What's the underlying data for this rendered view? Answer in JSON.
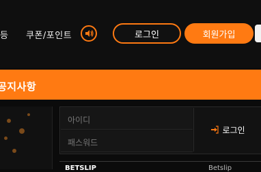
{
  "header": {
    "nav_partial": "등",
    "coupon_point_label": "쿠폰/포인트",
    "sound_icon": "speaker-icon",
    "login_button": "로그인",
    "signup_button": "회원가입"
  },
  "colors": {
    "accent": "#ff7a12",
    "background": "#0b0b0b",
    "panel": "#121212"
  },
  "notice": {
    "title": "공지사항"
  },
  "login_form": {
    "id_placeholder": "아이디",
    "password_placeholder": "패스워드",
    "submit_label": "로그인",
    "submit_icon": "sign-in-icon"
  },
  "bottom": {
    "left_label": "BETSLIP",
    "right_label": "Betslip"
  }
}
